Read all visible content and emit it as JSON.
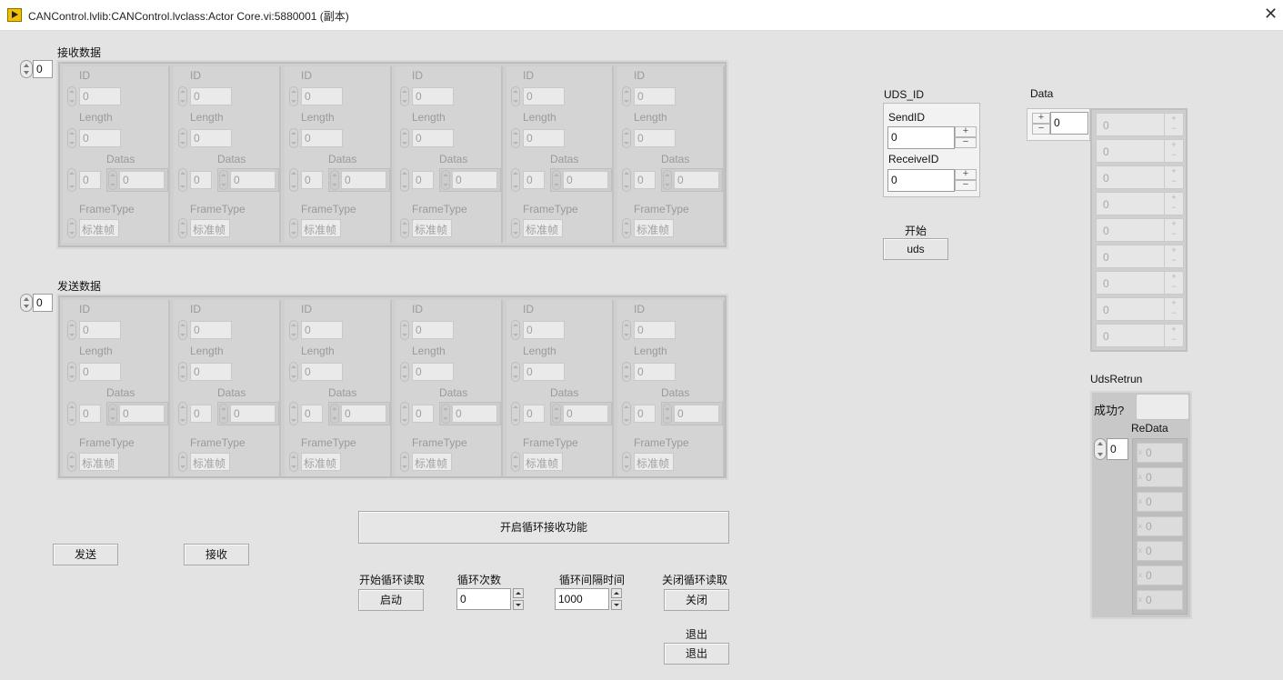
{
  "window": {
    "title": "CANControl.lvlib:CANControl.lvclass:Actor Core.vi:5880001 (副本)"
  },
  "receive": {
    "label": "接收数据",
    "index": "0"
  },
  "send": {
    "label": "发送数据",
    "index": "0"
  },
  "cluster_labels": {
    "id": "ID",
    "length": "Length",
    "datas": "Datas",
    "frame_type": "FrameType"
  },
  "cluster_values": {
    "id": "0",
    "length": "0",
    "datas_index": "0",
    "datas_value": "0",
    "frame_type": "标准帧"
  },
  "buttons": {
    "loop_receive": "开启循环接收功能",
    "send": "发送",
    "receive": "接收",
    "start_loop_label": "开始循环读取",
    "start_loop": "启动",
    "loop_count_label": "循环次数",
    "loop_count": "0",
    "loop_interval_label": "循环间隔时间",
    "loop_interval": "1000",
    "close_loop_label": "关闭循环读取",
    "close_loop": "关闭",
    "exit_label": "退出",
    "exit": "退出"
  },
  "uds_id": {
    "label": "UDS_ID",
    "send_id_label": "SendID",
    "send_id": "0",
    "receive_id_label": "ReceiveID",
    "receive_id": "0"
  },
  "uds_start": {
    "label": "开始",
    "button": "uds"
  },
  "data": {
    "label": "Data",
    "index": "0",
    "values": [
      "0",
      "0",
      "0",
      "0",
      "0",
      "0",
      "0",
      "0",
      "0"
    ]
  },
  "uds_return": {
    "label": "UdsRetrun",
    "success_label": "成功?",
    "redata_label": "ReData",
    "index": "0",
    "values": [
      "0",
      "0",
      "0",
      "0",
      "0",
      "0",
      "0"
    ]
  },
  "colors": {
    "background": "#e3e3e3",
    "panel_gray": "#cfcfcf",
    "icon_yellow": "#f2c200"
  }
}
